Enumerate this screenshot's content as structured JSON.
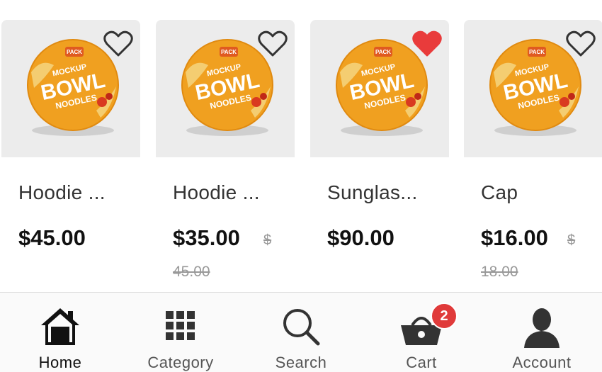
{
  "products": [
    {
      "name": "Hoodie ...",
      "price": "$45.00",
      "old_price_currency": "",
      "old_price_amount": "",
      "favorited": false
    },
    {
      "name": "Hoodie ...",
      "price": "$35.00",
      "old_price_currency": "$",
      "old_price_amount": "45.00",
      "favorited": false
    },
    {
      "name": "Sunglas...",
      "price": "$90.00",
      "old_price_currency": "",
      "old_price_amount": "",
      "favorited": true
    },
    {
      "name": "Cap",
      "price": "$16.00",
      "old_price_currency": "$",
      "old_price_amount": "18.00",
      "favorited": false
    }
  ],
  "product_image": {
    "badge": "PACK",
    "line1": "MOCKUP",
    "line2": "BOWL",
    "line3": "NOODLES"
  },
  "tabbar": {
    "home": "Home",
    "category": "Category",
    "search": "Search",
    "cart": "Cart",
    "account": "Account",
    "cart_count": "2"
  },
  "colors": {
    "accent_red": "#e03a3a",
    "bowl_orange": "#f0a020",
    "thumb_bg": "#ececec"
  },
  "icons": {
    "heart": "heart-icon",
    "home": "home-icon",
    "category": "grid-icon",
    "search": "search-icon",
    "cart": "basket-icon",
    "account": "user-icon"
  }
}
